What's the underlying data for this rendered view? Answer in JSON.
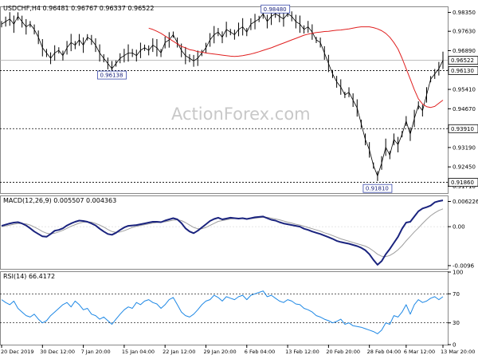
{
  "chart_data": [
    {
      "type": "line",
      "panel": "price",
      "title": "USDCHF,H4  0.96481 0.96767 0.96337 0.96522",
      "ylim": [
        0.9145,
        0.9855
      ],
      "y_ticks": [
        "0.98350",
        "0.97630",
        "0.96890",
        "0.96150",
        "0.95410",
        "0.94670",
        "0.93930",
        "0.93190",
        "0.92450",
        "0.91710"
      ],
      "y_tick_values": [
        0.9835,
        0.9763,
        0.9689,
        0.9615,
        0.9541,
        0.9467,
        0.9393,
        0.9319,
        0.9245,
        0.9171
      ],
      "current_price_label": "0.96522",
      "levels": [
        {
          "label": "0.96130",
          "value": 0.9613
        },
        {
          "label": "0.93910",
          "value": 0.9391
        },
        {
          "label": "0.91860",
          "value": 0.9186
        }
      ],
      "annotations": [
        {
          "label": "0.96138",
          "value": 0.9614,
          "at_index": 27
        },
        {
          "label": "0.98480",
          "value": 0.9848,
          "at_index": 67
        },
        {
          "label": "0.91810",
          "value": 0.9181,
          "at_index": 92
        }
      ],
      "series": [
        {
          "values": [
            0.979,
            0.98,
            0.981,
            0.979,
            0.982,
            0.98,
            0.978,
            0.979,
            0.977,
            0.974,
            0.97,
            0.968,
            0.966,
            0.968,
            0.969,
            0.967,
            0.97,
            0.972,
            0.971,
            0.973,
            0.971,
            0.974,
            0.973,
            0.971,
            0.968,
            0.966,
            0.964,
            0.962,
            0.964,
            0.966,
            0.967,
            0.968,
            0.968,
            0.967,
            0.969,
            0.97,
            0.969,
            0.971,
            0.97,
            0.968,
            0.972,
            0.973,
            0.975,
            0.972,
            0.969,
            0.967,
            0.966,
            0.965,
            0.966,
            0.968,
            0.97,
            0.973,
            0.975,
            0.976,
            0.974,
            0.977,
            0.976,
            0.975,
            0.977,
            0.978,
            0.976,
            0.979,
            0.98,
            0.981,
            0.983,
            0.98,
            0.982,
            0.983,
            0.982,
            0.981,
            0.983,
            0.982,
            0.98,
            0.979,
            0.977,
            0.978,
            0.976,
            0.973,
            0.972,
            0.968,
            0.964,
            0.96,
            0.957,
            0.955,
            0.952,
            0.953,
            0.95,
            0.947,
            0.941,
            0.935,
            0.931,
            0.925,
            0.921,
            0.926,
            0.932,
            0.929,
            0.935,
            0.933,
            0.937,
            0.942,
            0.937,
            0.943,
            0.948,
            0.946,
            0.952,
            0.958,
            0.96,
            0.962,
            0.9652
          ],
          "color": "#000000"
        },
        {
          "values": [
            0.9775,
            0.977,
            0.9763,
            0.9755,
            0.9745,
            0.9735,
            0.9725,
            0.9715,
            0.9705,
            0.97,
            0.9693,
            0.969,
            0.9685,
            0.9683,
            0.968,
            0.9678,
            0.9676,
            0.9674,
            0.9672,
            0.967,
            0.9668,
            0.9667,
            0.9668,
            0.967,
            0.9673,
            0.9676,
            0.968,
            0.9685,
            0.969,
            0.9695,
            0.97,
            0.9706,
            0.9712,
            0.9718,
            0.9724,
            0.973,
            0.9736,
            0.9742,
            0.9748,
            0.9752,
            0.9755,
            0.9758,
            0.976,
            0.9762,
            0.9763,
            0.9765,
            0.9767,
            0.9768,
            0.977,
            0.9772,
            0.9775,
            0.9778,
            0.978,
            0.978,
            0.978,
            0.9777,
            0.9772,
            0.9765,
            0.9755,
            0.974,
            0.972,
            0.9695,
            0.966,
            0.962,
            0.958,
            0.954,
            0.9505,
            0.9485,
            0.9475,
            0.9472,
            0.9476,
            0.9488,
            0.95
          ],
          "start_index": 36,
          "color": "#e02020"
        }
      ],
      "x_ticks": [
        "20 Dec 2019",
        "30 Dec 12:00",
        "7 Jan 20:00",
        "15 Jan 04:00",
        "22 Jan 12:00",
        "29 Jan 20:00",
        "6 Feb 04:00",
        "13 Feb 12:00",
        "20 Feb 20:00",
        "28 Feb 04:00",
        "6 Mar 12:00",
        "13 Mar 20:00"
      ],
      "x_tick_indices": [
        0,
        10,
        20,
        30,
        40,
        50,
        60,
        70,
        80,
        90,
        99,
        108
      ],
      "watermark": "ActionForex.com"
    },
    {
      "type": "line",
      "panel": "macd",
      "title": "MACD(12,26,9) 0.005507 0.004363",
      "ylim": [
        -0.0104,
        0.0075
      ],
      "y_ticks": [
        "0.006226",
        "0.00",
        "-0.0096"
      ],
      "y_tick_values": [
        0.006226,
        0.0,
        -0.0096
      ],
      "series": [
        {
          "values": [
            0.0002,
            0.0005,
            0.0008,
            0.001,
            0.0011,
            0.0008,
            0.0003,
            -0.0004,
            -0.0012,
            -0.0018,
            -0.0024,
            -0.0025,
            -0.0018,
            -0.001,
            -0.0008,
            -0.0004,
            0.0003,
            0.0008,
            0.0012,
            0.0015,
            0.0014,
            0.0012,
            0.0008,
            0.0003,
            -0.0005,
            -0.0012,
            -0.0018,
            -0.002,
            -0.0015,
            -0.0008,
            -0.0002,
            0.0002,
            0.0003,
            0.0004,
            0.0006,
            0.0008,
            0.001,
            0.0012,
            0.0012,
            0.0011,
            0.0015,
            0.0018,
            0.0021,
            0.0018,
            0.0009,
            -0.0004,
            -0.0012,
            -0.0016,
            -0.001,
            -0.0002,
            0.0006,
            0.0014,
            0.0019,
            0.0022,
            0.0018,
            0.002,
            0.0022,
            0.0021,
            0.002,
            0.0021,
            0.0019,
            0.0021,
            0.0023,
            0.0024,
            0.0025,
            0.0021,
            0.0017,
            0.0015,
            0.0011,
            0.0008,
            0.0006,
            0.0004,
            0.0002,
            0.0,
            -0.0005,
            -0.0008,
            -0.0012,
            -0.0015,
            -0.0018,
            -0.0022,
            -0.0026,
            -0.003,
            -0.0035,
            -0.0038,
            -0.004,
            -0.0042,
            -0.0045,
            -0.0048,
            -0.0052,
            -0.0058,
            -0.0068,
            -0.0082,
            -0.0094,
            -0.0085,
            -0.0068,
            -0.0055,
            -0.004,
            -0.0025,
            -0.0005,
            0.001,
            0.0012,
            0.0025,
            0.0038,
            0.0045,
            0.0048,
            0.0052,
            0.006,
            0.0063,
            0.0065
          ],
          "color": "#1a237e"
        },
        {
          "values": [
            0.0,
            0.0002,
            0.0004,
            0.0006,
            0.0008,
            0.0008,
            0.0007,
            0.0004,
            -0.0001,
            -0.0006,
            -0.0012,
            -0.0016,
            -0.0018,
            -0.0016,
            -0.0013,
            -0.0009,
            -0.0004,
            0.0001,
            0.0005,
            0.0009,
            0.0011,
            0.0012,
            0.0011,
            0.0008,
            0.0004,
            -0.0001,
            -0.0007,
            -0.0012,
            -0.0014,
            -0.0013,
            -0.001,
            -0.0006,
            -0.0002,
            0.0001,
            0.0003,
            0.0005,
            0.0007,
            0.0009,
            0.001,
            0.0011,
            0.0012,
            0.0014,
            0.0016,
            0.0017,
            0.0015,
            0.001,
            0.0004,
            -0.0002,
            -0.0005,
            -0.0005,
            -0.0002,
            0.0003,
            0.0008,
            0.0013,
            0.0015,
            0.0017,
            0.0019,
            0.002,
            0.002,
            0.002,
            0.002,
            0.002,
            0.0021,
            0.0022,
            0.0023,
            0.0023,
            0.0021,
            0.0019,
            0.0017,
            0.0014,
            0.0011,
            0.0009,
            0.0006,
            0.0004,
            0.0001,
            -0.0002,
            -0.0005,
            -0.0008,
            -0.0011,
            -0.0015,
            -0.0018,
            -0.0022,
            -0.0026,
            -0.003,
            -0.0033,
            -0.0036,
            -0.0039,
            -0.0042,
            -0.0045,
            -0.0048,
            -0.0053,
            -0.006,
            -0.0068,
            -0.0073,
            -0.0074,
            -0.0071,
            -0.0065,
            -0.0057,
            -0.0047,
            -0.0035,
            -0.0024,
            -0.0013,
            -0.0003,
            0.0008,
            0.0018,
            0.0027,
            0.0034,
            0.004,
            0.0044
          ],
          "color": "#9e9e9e"
        }
      ]
    },
    {
      "type": "line",
      "panel": "rsi",
      "title": "RSI(14) 66.4172",
      "ylim": [
        0,
        100
      ],
      "y_ticks": [
        "100",
        "70",
        "30",
        "0"
      ],
      "y_tick_values": [
        100,
        70,
        30,
        0
      ],
      "series": [
        {
          "values": [
            62,
            58,
            55,
            60,
            50,
            45,
            40,
            38,
            42,
            35,
            30,
            33,
            40,
            45,
            50,
            55,
            58,
            52,
            60,
            55,
            48,
            50,
            42,
            40,
            35,
            38,
            33,
            28,
            35,
            42,
            48,
            52,
            50,
            58,
            55,
            60,
            62,
            58,
            56,
            50,
            55,
            62,
            65,
            55,
            45,
            40,
            38,
            42,
            48,
            55,
            60,
            62,
            68,
            65,
            60,
            66,
            64,
            62,
            66,
            68,
            62,
            68,
            70,
            72,
            74,
            66,
            68,
            64,
            60,
            58,
            62,
            60,
            56,
            55,
            50,
            48,
            45,
            40,
            38,
            35,
            33,
            30,
            32,
            35,
            28,
            30,
            26,
            25,
            24,
            22,
            20,
            18,
            15,
            20,
            30,
            28,
            40,
            38,
            45,
            55,
            42,
            55,
            62,
            58,
            60,
            64,
            66,
            62,
            66
          ],
          "color": "#1e88e5"
        }
      ]
    }
  ]
}
